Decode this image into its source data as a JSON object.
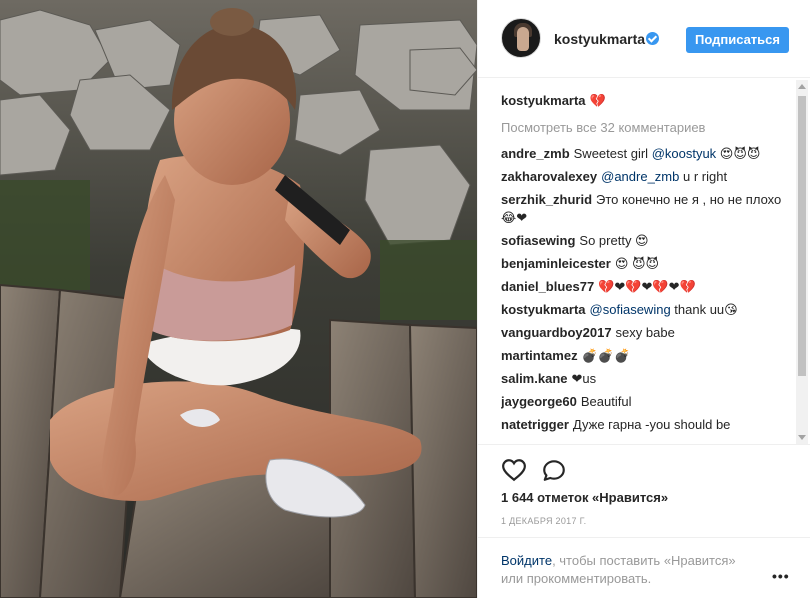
{
  "post": {
    "username": "kostyukmarta",
    "follow_label": "Подписаться",
    "caption": {
      "user": "kostyukmarta",
      "text": "💔"
    },
    "view_all": "Посмотреть все 32 комментариев",
    "comments": [
      {
        "user": "andre_zmb",
        "text": "Sweetest girl",
        "mention": "@koostyuk",
        "suffix": " 😍😈😈"
      },
      {
        "user": "zakharovalexey",
        "text": "",
        "mention": "@andre_zmb",
        "suffix": " u r right"
      },
      {
        "user": "serzhik_zhurid",
        "text": "Это конечно не я , но не плохо 😂❤",
        "mention": "",
        "suffix": ""
      },
      {
        "user": "sofiasewing",
        "text": "So pretty 😍",
        "mention": "",
        "suffix": ""
      },
      {
        "user": "benjaminleicester",
        "text": "😍 😈😈",
        "mention": "",
        "suffix": ""
      },
      {
        "user": "daniel_blues77",
        "text": "💔❤💔❤💔❤💔",
        "mention": "",
        "suffix": ""
      },
      {
        "user": "kostyukmarta",
        "text": "",
        "mention": "@sofiasewing",
        "suffix": " thank uu😘"
      },
      {
        "user": "vanguardboy2017",
        "text": "sexy babe",
        "mention": "",
        "suffix": ""
      },
      {
        "user": "martintamez",
        "text": "💣💣💣",
        "mention": "",
        "suffix": ""
      },
      {
        "user": "salim.kane",
        "text": "❤us",
        "mention": "",
        "suffix": ""
      },
      {
        "user": "jaygeorge60",
        "text": "Beautiful",
        "mention": "",
        "suffix": ""
      },
      {
        "user": "natetrigger",
        "text": "Дуже гарна -you should be",
        "mention": "",
        "suffix": ""
      }
    ],
    "likes": "1 644 отметок «Нравится»",
    "date": "1 ДЕКАБРЯ 2017 Г.",
    "login": {
      "link": "Войдите",
      "text": ", чтобы поставить «Нравится» или прокомментировать."
    },
    "more": "•••"
  },
  "icons": {
    "like": "heart-icon",
    "comment": "comment-icon",
    "verified": "verified-badge-icon",
    "more": "more-options-icon"
  },
  "colors": {
    "accent": "#3897f0",
    "link": "#003569",
    "muted": "#999999",
    "text": "#262626"
  }
}
